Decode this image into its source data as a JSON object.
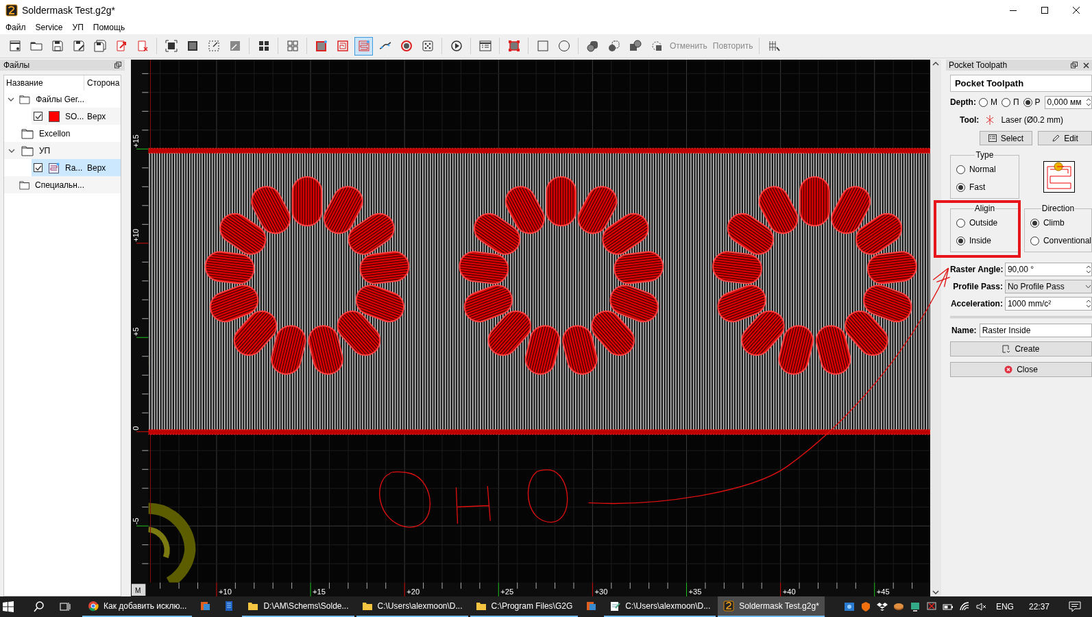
{
  "window": {
    "title": "Soldermask Test.g2g*"
  },
  "menu": [
    "Файл",
    "Service",
    "УП",
    "Помощь"
  ],
  "toolbar": [
    [
      {
        "kind": "icon",
        "selected": false
      },
      {
        "kind": "icon",
        "selected": false
      },
      {
        "kind": "icon",
        "selected": false
      },
      {
        "kind": "icon",
        "selected": false
      },
      {
        "kind": "icon",
        "selected": false
      },
      {
        "kind": "icon",
        "selected": false
      },
      {
        "kind": "icon",
        "selected": false
      }
    ],
    [
      {
        "kind": "icon",
        "selected": false
      },
      {
        "kind": "icon",
        "selected": false
      },
      {
        "kind": "icon",
        "selected": false
      },
      {
        "kind": "icon",
        "selected": false
      }
    ],
    [
      {
        "kind": "icon",
        "selected": false
      }
    ],
    [
      {
        "kind": "icon",
        "selected": false
      }
    ],
    [
      {
        "kind": "icon",
        "selected": false
      },
      {
        "kind": "icon",
        "selected": false
      },
      {
        "kind": "icon",
        "selected": true
      },
      {
        "kind": "icon",
        "selected": false
      },
      {
        "kind": "icon",
        "selected": false
      },
      {
        "kind": "icon",
        "selected": false
      }
    ],
    [
      {
        "kind": "icon",
        "selected": false
      }
    ],
    [
      {
        "kind": "icon",
        "selected": false
      }
    ],
    [
      {
        "kind": "icon",
        "selected": false
      }
    ],
    [
      {
        "kind": "icon",
        "selected": false
      },
      {
        "kind": "icon",
        "selected": false
      }
    ],
    [
      {
        "kind": "icon",
        "selected": false
      },
      {
        "kind": "icon",
        "selected": false
      },
      {
        "kind": "icon",
        "selected": false
      },
      {
        "kind": "icon",
        "selected": false
      },
      {
        "kind": "text",
        "label": "Отменить",
        "disabled": true
      },
      {
        "kind": "text",
        "label": "Повторить",
        "disabled": true
      }
    ],
    [
      {
        "kind": "icon",
        "selected": false
      }
    ]
  ],
  "files_panel": {
    "title": "Файлы",
    "columns": [
      "Название",
      "Сторона"
    ],
    "tree": [
      {
        "label": "Файлы Ger...",
        "expanded": true,
        "selected": false,
        "children": [
          {
            "kind": "layer",
            "label": "SO...",
            "side": "Верх",
            "checked": true,
            "color": "#ff0000",
            "selected": false
          }
        ]
      },
      {
        "label": "Excellon",
        "selected": false
      },
      {
        "label": "УП",
        "expanded": true,
        "selected": false,
        "children": [
          {
            "kind": "toolpath",
            "label": "Ra...",
            "side": "Верх",
            "checked": true,
            "selected": true
          }
        ]
      },
      {
        "label": "Специальн...",
        "selected": false
      }
    ]
  },
  "canvas": {
    "left_ruler": [
      "+15",
      "+10",
      "+5",
      "0",
      "-5"
    ],
    "bottom_ruler": [
      "+10",
      "+15",
      "+20",
      "+25",
      "+30",
      "+35",
      "+40",
      "+45"
    ],
    "corner_button": "M"
  },
  "toolpath_panel": {
    "title": "Pocket Toolpath",
    "heading": "Pocket Toolpath",
    "depth": {
      "label": "Depth:",
      "options": [
        {
          "label": "M",
          "selected": false
        },
        {
          "label": "П",
          "selected": false
        },
        {
          "label": "Р",
          "selected": true
        }
      ],
      "value": "0,000 мм"
    },
    "tool": {
      "label": "Tool:",
      "value": "Laser (Ø0.2 mm)"
    },
    "buttons": [
      {
        "kind": "select",
        "label": "Select"
      },
      {
        "kind": "edit",
        "label": "Edit"
      }
    ],
    "groups": [
      {
        "title": "Type",
        "highlighted": false,
        "options": [
          {
            "label": "Normal",
            "selected": false
          },
          {
            "label": "Fast",
            "selected": true
          }
        ]
      },
      {
        "title": "Aligin",
        "highlighted": true,
        "options": [
          {
            "label": "Outside",
            "selected": false
          },
          {
            "label": "Inside",
            "selected": true
          }
        ]
      },
      {
        "title": "Direction",
        "highlighted": false,
        "options": [
          {
            "label": "Climb",
            "selected": true
          },
          {
            "label": "Conventional",
            "selected": false
          }
        ]
      }
    ],
    "fields": [
      {
        "kind": "spin",
        "label": "Raster Angle:",
        "value": "90,00 °"
      },
      {
        "kind": "dropdown",
        "label": "Profile Pass:",
        "value": "No Profile Pass"
      },
      {
        "kind": "spin",
        "label": "Acceleration:",
        "value": "1000 mm/c²"
      }
    ],
    "name": {
      "label": "Name:",
      "value": "Raster Inside"
    },
    "actions": [
      {
        "kind": "create",
        "label": "Create"
      },
      {
        "kind": "close",
        "label": "Close"
      }
    ]
  },
  "taskbar": {
    "apps": [
      {
        "kind": "chrome",
        "label": "Как добавить исклю...",
        "running": true,
        "active": false
      },
      {
        "kind": "app",
        "running": false,
        "active": false
      },
      {
        "kind": "app2",
        "running": false,
        "active": false
      },
      {
        "kind": "folder",
        "label": "D:\\AM\\Schems\\Solde...",
        "running": true,
        "active": false
      },
      {
        "kind": "folder",
        "label": "C:\\Users\\alexmoon\\D...",
        "running": true,
        "active": false
      },
      {
        "kind": "folder",
        "label": "C:\\Program Files\\G2G",
        "running": true,
        "active": false
      },
      {
        "kind": "app",
        "running": false,
        "active": false
      },
      {
        "kind": "notepad",
        "label": "C:\\Users\\alexmoon\\D...",
        "running": true,
        "active": false
      },
      {
        "kind": "g2g",
        "label": "Soldermask Test.g2g*",
        "running": true,
        "active": true
      }
    ],
    "language": "ENG",
    "time": "22:37"
  }
}
